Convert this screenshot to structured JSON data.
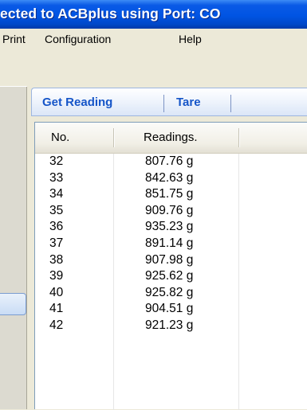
{
  "window": {
    "title": "ected to ACBplus using Port: CO"
  },
  "menu": {
    "items": [
      "Print",
      "Configuration",
      "Help"
    ]
  },
  "toolbar": {
    "get_reading": "Get Reading",
    "tare": "Tare"
  },
  "table": {
    "columns": [
      "No.",
      "Readings."
    ],
    "rows": [
      {
        "no": "32",
        "reading": "807.76 g"
      },
      {
        "no": "33",
        "reading": "842.63 g"
      },
      {
        "no": "34",
        "reading": "851.75 g"
      },
      {
        "no": "35",
        "reading": "909.76 g"
      },
      {
        "no": "36",
        "reading": "935.23 g"
      },
      {
        "no": "37",
        "reading": "891.14 g"
      },
      {
        "no": "38",
        "reading": "907.98 g"
      },
      {
        "no": "39",
        "reading": "925.62 g"
      },
      {
        "no": "40",
        "reading": "925.82 g"
      },
      {
        "no": "41",
        "reading": "904.51 g"
      },
      {
        "no": "42",
        "reading": "921.23 g"
      }
    ]
  },
  "colors": {
    "titlebar": "#0054e3",
    "tab_text": "#1555c8",
    "window_bg": "#ece9d8"
  }
}
